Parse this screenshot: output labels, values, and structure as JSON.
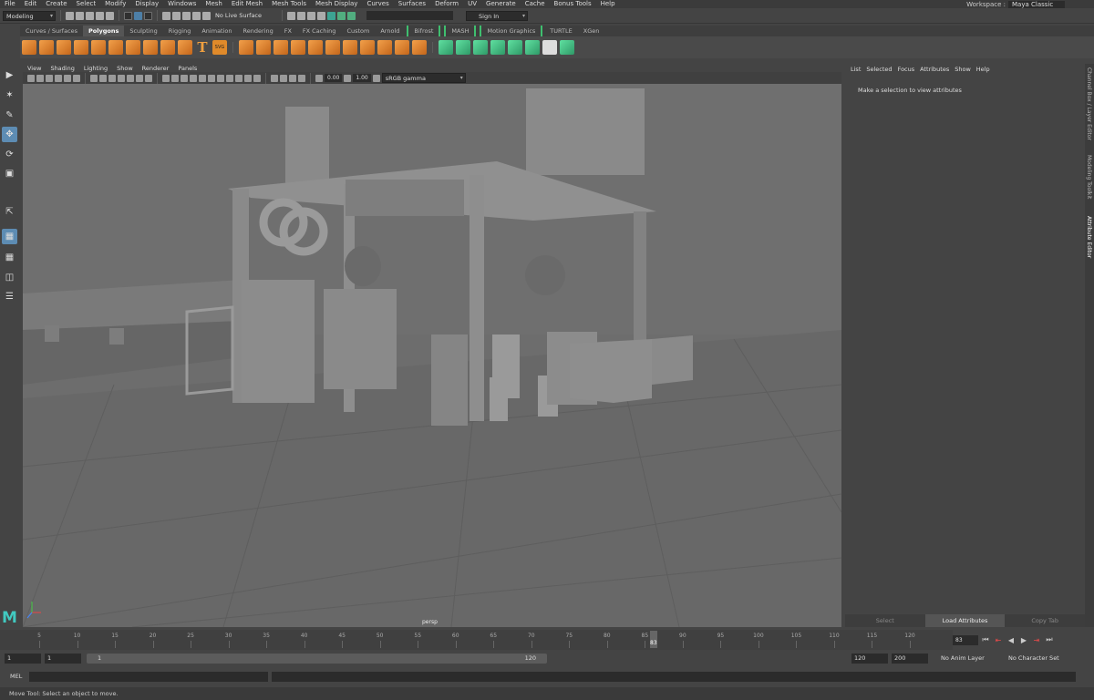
{
  "menubar": {
    "items": [
      "File",
      "Edit",
      "Create",
      "Select",
      "Modify",
      "Display",
      "Windows",
      "Mesh",
      "Edit Mesh",
      "Mesh Tools",
      "Mesh Display",
      "Curves",
      "Surfaces",
      "Deform",
      "UV",
      "Generate",
      "Cache",
      "Bonus Tools",
      "Help"
    ],
    "workspace_label": "Workspace :",
    "workspace_value": "Maya Classic"
  },
  "statusline": {
    "mode": "Modeling",
    "live_surface": "No Live Surface",
    "sign_in": "Sign In"
  },
  "shelf": {
    "tabs": [
      "Curves / Surfaces",
      "Polygons",
      "Sculpting",
      "Rigging",
      "Animation",
      "Rendering",
      "FX",
      "FX Caching",
      "Custom",
      "Arnold",
      "Bifrost",
      "MASH",
      "Motion Graphics",
      "TURTLE",
      "XGen"
    ],
    "active_tab": "Polygons",
    "green_tabs": [
      "Bifrost",
      "MASH",
      "Motion Graphics"
    ],
    "svg_icon_label": "SVG"
  },
  "viewport": {
    "menu": [
      "View",
      "Shading",
      "Lighting",
      "Show",
      "Renderer",
      "Panels"
    ],
    "exposure": "0.00",
    "gamma": "1.00",
    "color_space": "sRGB gamma",
    "camera_label": "persp"
  },
  "attribute_editor": {
    "menu": [
      "List",
      "Selected",
      "Focus",
      "Attributes",
      "Show",
      "Help"
    ],
    "message": "Make a selection to view attributes",
    "buttons": [
      "Select",
      "Load Attributes",
      "Copy Tab"
    ]
  },
  "side_tabs": [
    "Channel Box / Layer Editor",
    "Modeling Toolkit",
    "Attribute Editor"
  ],
  "timeline": {
    "ticks": [
      "5",
      "10",
      "15",
      "20",
      "25",
      "30",
      "35",
      "40",
      "45",
      "50",
      "55",
      "60",
      "65",
      "70",
      "75",
      "80",
      "85",
      "90",
      "95",
      "100",
      "105",
      "110",
      "115",
      "120"
    ],
    "current_frame": "83",
    "current_frame_field": "83"
  },
  "range": {
    "start": "1",
    "playback_start": "1",
    "slider_start": "1",
    "slider_end": "120",
    "playback_end": "120",
    "end": "200",
    "anim_layer": "No Anim Layer",
    "character_set": "No Character Set"
  },
  "command": {
    "language": "MEL"
  },
  "help_line": "Move Tool: Select an object to move."
}
